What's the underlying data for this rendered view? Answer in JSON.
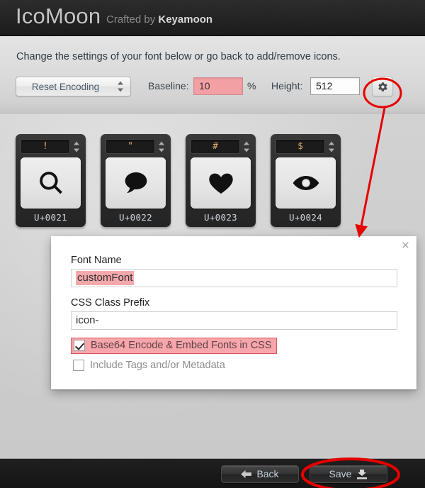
{
  "header": {
    "brand": "IcoMoon",
    "crafted_prefix": "Crafted by ",
    "crafted_author": "Keyamoon"
  },
  "toolbar": {
    "intro": "Change the settings of your font below or go back to add/remove icons.",
    "encoding_select": "Reset Encoding",
    "baseline_label": "Baseline:",
    "baseline_value": "10",
    "percent_label": "%",
    "height_label": "Height:",
    "height_value": "512",
    "gear_title": "gear"
  },
  "icons": [
    {
      "char": "!",
      "code": "U+0021",
      "glyph": "search-icon"
    },
    {
      "char": "\"",
      "code": "U+0022",
      "glyph": "speech-bubble-icon"
    },
    {
      "char": "#",
      "code": "U+0023",
      "glyph": "heart-icon"
    },
    {
      "char": "$",
      "code": "U+0024",
      "glyph": "eye-icon"
    }
  ],
  "modal": {
    "close_label": "×",
    "font_name_label": "Font Name",
    "font_name_value": "customFont",
    "css_prefix_label": "CSS Class Prefix",
    "css_prefix_value": "icon-",
    "checkbox_base64_label": "Base64 Encode & Embed Fonts in CSS",
    "checkbox_base64_checked": true,
    "checkbox_metadata_label": "Include Tags and/or Metadata",
    "checkbox_metadata_checked": false
  },
  "footer": {
    "back_label": "Back",
    "save_label": "Save"
  },
  "annotations": {
    "highlight_color": "#e60000",
    "selection_color": "#f5a8ac"
  }
}
